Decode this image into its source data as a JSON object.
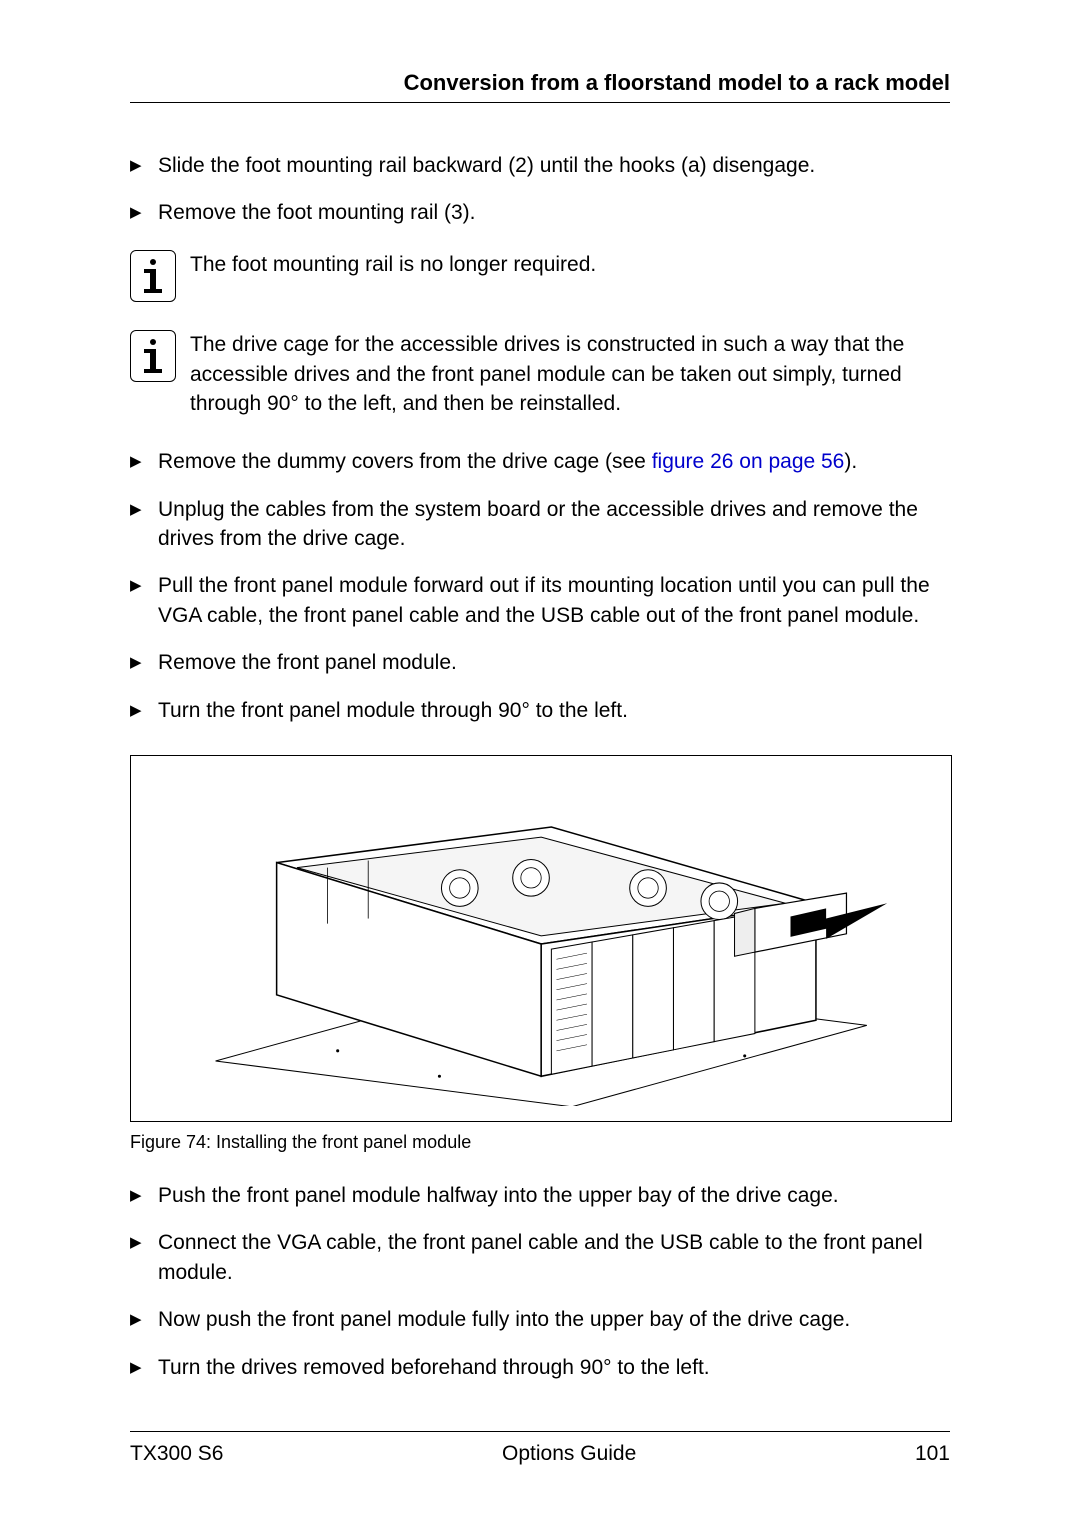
{
  "header": {
    "section_title": "Conversion from a floorstand model to a rack model"
  },
  "steps_a": [
    "Slide the foot mounting rail backward (2) until the hooks (a) disengage.",
    "Remove the foot mounting rail (3)."
  ],
  "info_a": "The foot mounting rail is no longer required.",
  "info_b": "The drive cage for the accessible drives is constructed in such a way that the accessible drives and the front panel module can be taken out simply, turned through 90° to the left, and then be reinstalled.",
  "steps_b": [
    {
      "pre": "Remove the dummy covers from the drive cage (see ",
      "link": "figure 26 on page 56",
      "post": ")."
    },
    {
      "pre": "Unplug the cables from the system board or the accessible drives and remove the drives from the drive cage."
    },
    {
      "pre": "Pull the front panel module forward out if its mounting location until you can pull the VGA cable, the front panel cable and the USB cable out of the front panel module."
    },
    {
      "pre": "Remove the front panel module."
    },
    {
      "pre": "Turn the front panel module through 90° to the left."
    }
  ],
  "figure": {
    "caption": "Figure 74: Installing the front panel module"
  },
  "steps_c": [
    "Push the front panel module halfway into the upper bay of the drive cage.",
    "Connect the VGA cable, the front panel cable and the USB cable to the front panel module.",
    "Now push the front panel module fully into the upper bay of the drive cage.",
    "Turn the drives removed beforehand through 90° to the left."
  ],
  "footer": {
    "left": "TX300 S6",
    "center": "Options Guide",
    "right": "101"
  }
}
